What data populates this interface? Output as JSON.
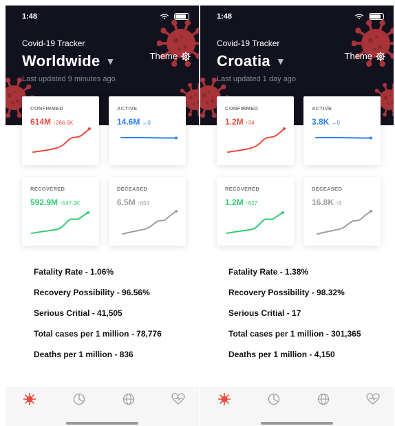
{
  "colors": {
    "header_bg": "#12121f",
    "virus": "#a8343a",
    "confirmed": "#e74c3c",
    "active": "#2f80ed",
    "recovered": "#2ecc71",
    "deceased": "#9e9e9e",
    "tab_active": "#e74c3c",
    "tab_inactive": "#9e9e9e"
  },
  "screens": [
    {
      "status_time": "1:48",
      "app_title": "Covid-19 Tracker",
      "country": "Worldwide",
      "caret": "▼",
      "theme_label": "Theme",
      "last_updated": "Last updated 9 minutes ago",
      "cards": {
        "confirmed": {
          "label": "CONFIRMED",
          "value": "614M",
          "delta": "↑266.6K"
        },
        "active": {
          "label": "ACTIVE",
          "value": "14.6M",
          "delta": "→0"
        },
        "recovered": {
          "label": "RECOVERED",
          "value": "592.9M",
          "delta": "↑547.2K"
        },
        "deceased": {
          "label": "DECEASED",
          "value": "6.5M",
          "delta": "↑654"
        }
      },
      "stats": [
        "Fatality Rate - 1.06%",
        "Recovery Possibility - 96.56%",
        "Serious Critial - 41,505",
        "Total cases per 1 million - 78,776",
        "Deaths per 1 million - 836"
      ]
    },
    {
      "status_time": "1:48",
      "app_title": "Covid-19 Tracker",
      "country": "Croatia",
      "caret": "▼",
      "theme_label": "Theme",
      "last_updated": "Last updated 1 day ago",
      "cards": {
        "confirmed": {
          "label": "CONFIRMED",
          "value": "1.2M",
          "delta": "↑34"
        },
        "active": {
          "label": "ACTIVE",
          "value": "3.8K",
          "delta": "→0"
        },
        "recovered": {
          "label": "RECOVERED",
          "value": "1.2M",
          "delta": "↑627"
        },
        "deceased": {
          "label": "DECEASED",
          "value": "16.8K",
          "delta": "↑9"
        }
      },
      "stats": [
        "Fatality Rate - 1.38%",
        "Recovery Possibility - 98.32%",
        "Serious Critial - 17",
        "Total cases per 1 million - 301,365",
        "Deaths per 1 million - 4,150"
      ]
    }
  ],
  "tabs": [
    {
      "icon": "virus-icon",
      "active": true
    },
    {
      "icon": "pie-chart-icon",
      "active": false
    },
    {
      "icon": "globe-icon",
      "active": false
    },
    {
      "icon": "heart-pulse-icon",
      "active": false
    }
  ]
}
